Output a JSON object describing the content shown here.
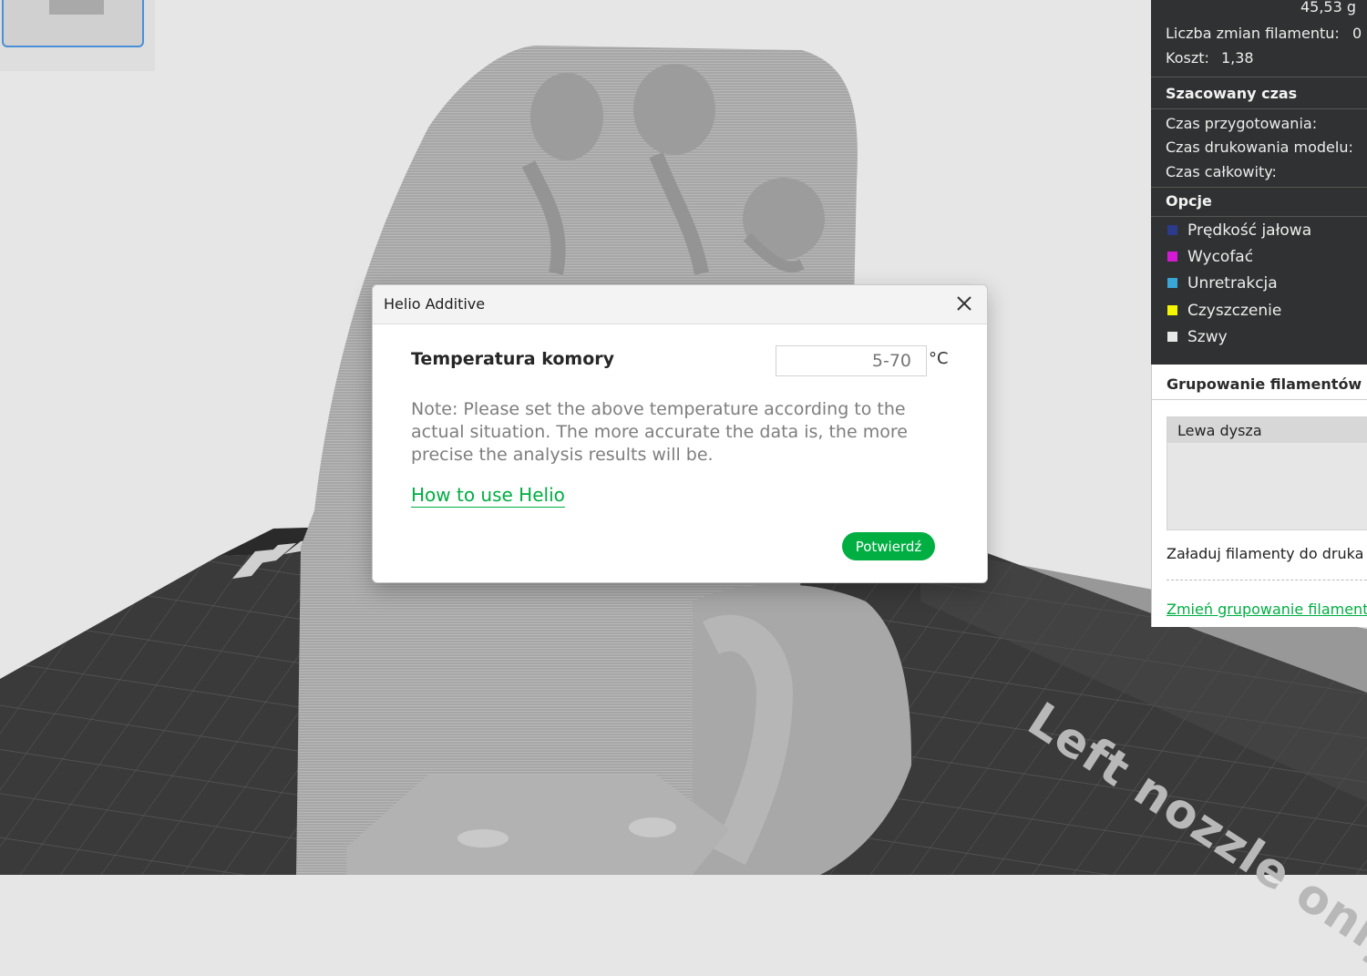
{
  "viewport": {
    "bed_label": "Left nozzle only"
  },
  "sidebar": {
    "weight": "45,53 g",
    "filament_changes_label": "Liczba zmian filamentu:",
    "filament_changes_value": "0",
    "cost_label": "Koszt:",
    "cost_value": "1,38",
    "estimated_time_header": "Szacowany czas",
    "prep_time_label": "Czas przygotowania:",
    "print_time_label": "Czas drukowania modelu:",
    "total_time_label": "Czas całkowity:",
    "options_header": "Opcje",
    "legend": [
      {
        "label": "Prędkość jałowa",
        "color": "#2c3a8c"
      },
      {
        "label": "Wycofać",
        "color": "#d41ad4"
      },
      {
        "label": "Unretrakcja",
        "color": "#3aa6d6"
      },
      {
        "label": "Czyszczenie",
        "color": "#f5f500"
      },
      {
        "label": "Szwy",
        "color": "#e8e8e8"
      }
    ],
    "grouping_title": "Grupowanie filamentów",
    "left_nozzle": "Lewa dysza",
    "load_text": "Załaduj filamenty do druka",
    "change_grouping_link": "Zmień grupowanie filament"
  },
  "modal": {
    "title": "Helio Additive",
    "field_label": "Temperatura komory",
    "input_placeholder": "5-70",
    "unit": "°C",
    "note": "Note: Please set the above temperature according to the actual situation. The more accurate the data is, the more precise the analysis results will be.",
    "help_link": "How to use Helio",
    "confirm_label": "Potwierdź"
  },
  "colors": {
    "accent": "#00ae42",
    "panel_dark": "#2f3132"
  }
}
